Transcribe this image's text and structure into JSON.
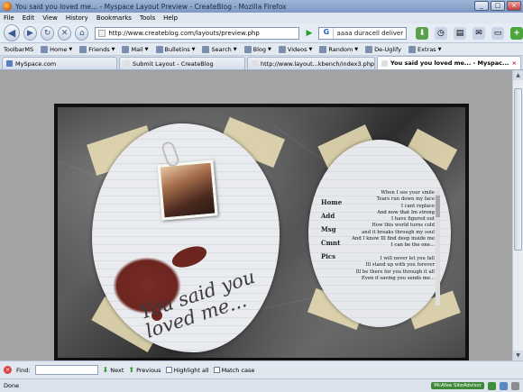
{
  "window": {
    "title": "You said you loved me... - Myspace Layout Preview - CreateBlog - Mozilla Firefox",
    "buttons": [
      "_",
      "□",
      "×"
    ]
  },
  "menu": [
    "File",
    "Edit",
    "View",
    "History",
    "Bookmarks",
    "Tools",
    "Help"
  ],
  "nav": {
    "url": "http://www.createblog.com/layouts/preview.php",
    "search_engine": "G",
    "search_query": "aaaa duracell deliver"
  },
  "toolbar": [
    "ToolbarMS",
    "Home",
    "Friends",
    "Mail",
    "Bulletins",
    "Search",
    "Blog",
    "Videos",
    "Random",
    "De-Uglify",
    "Extras"
  ],
  "tabs": [
    {
      "label": "MySpace.com",
      "active": false
    },
    {
      "label": "Submit Layout - CreateBlog",
      "active": false
    },
    {
      "label": "http://www.layout...kbench/index3.php",
      "active": false
    },
    {
      "label": "You said you loved me... - Myspac...",
      "active": true
    }
  ],
  "page": {
    "title_script": "You said you\nloved me...",
    "nav_links": [
      "Home",
      "Add",
      "Msg",
      "Cmnt",
      "Pics"
    ],
    "lyrics": "When I see your smile\nTears run down my face\nI cant replace\nAnd now that Im strong\nI have figured out\nHow this world turns cold\nand it breaks through my soul\nAnd I know Ill find deep inside me\nI can be the one...\n\nI will never let you fall\nIll stand up with you forever\nIll be there for you through it all\nEven if saving you sends me..."
  },
  "findbar": {
    "label": "Find:",
    "next": "Next",
    "previous": "Previous",
    "highlight": "Highlight all",
    "match_case": "Match case"
  },
  "status": {
    "text": "Done",
    "mcafee": "McAfee SiteAdvisor"
  }
}
